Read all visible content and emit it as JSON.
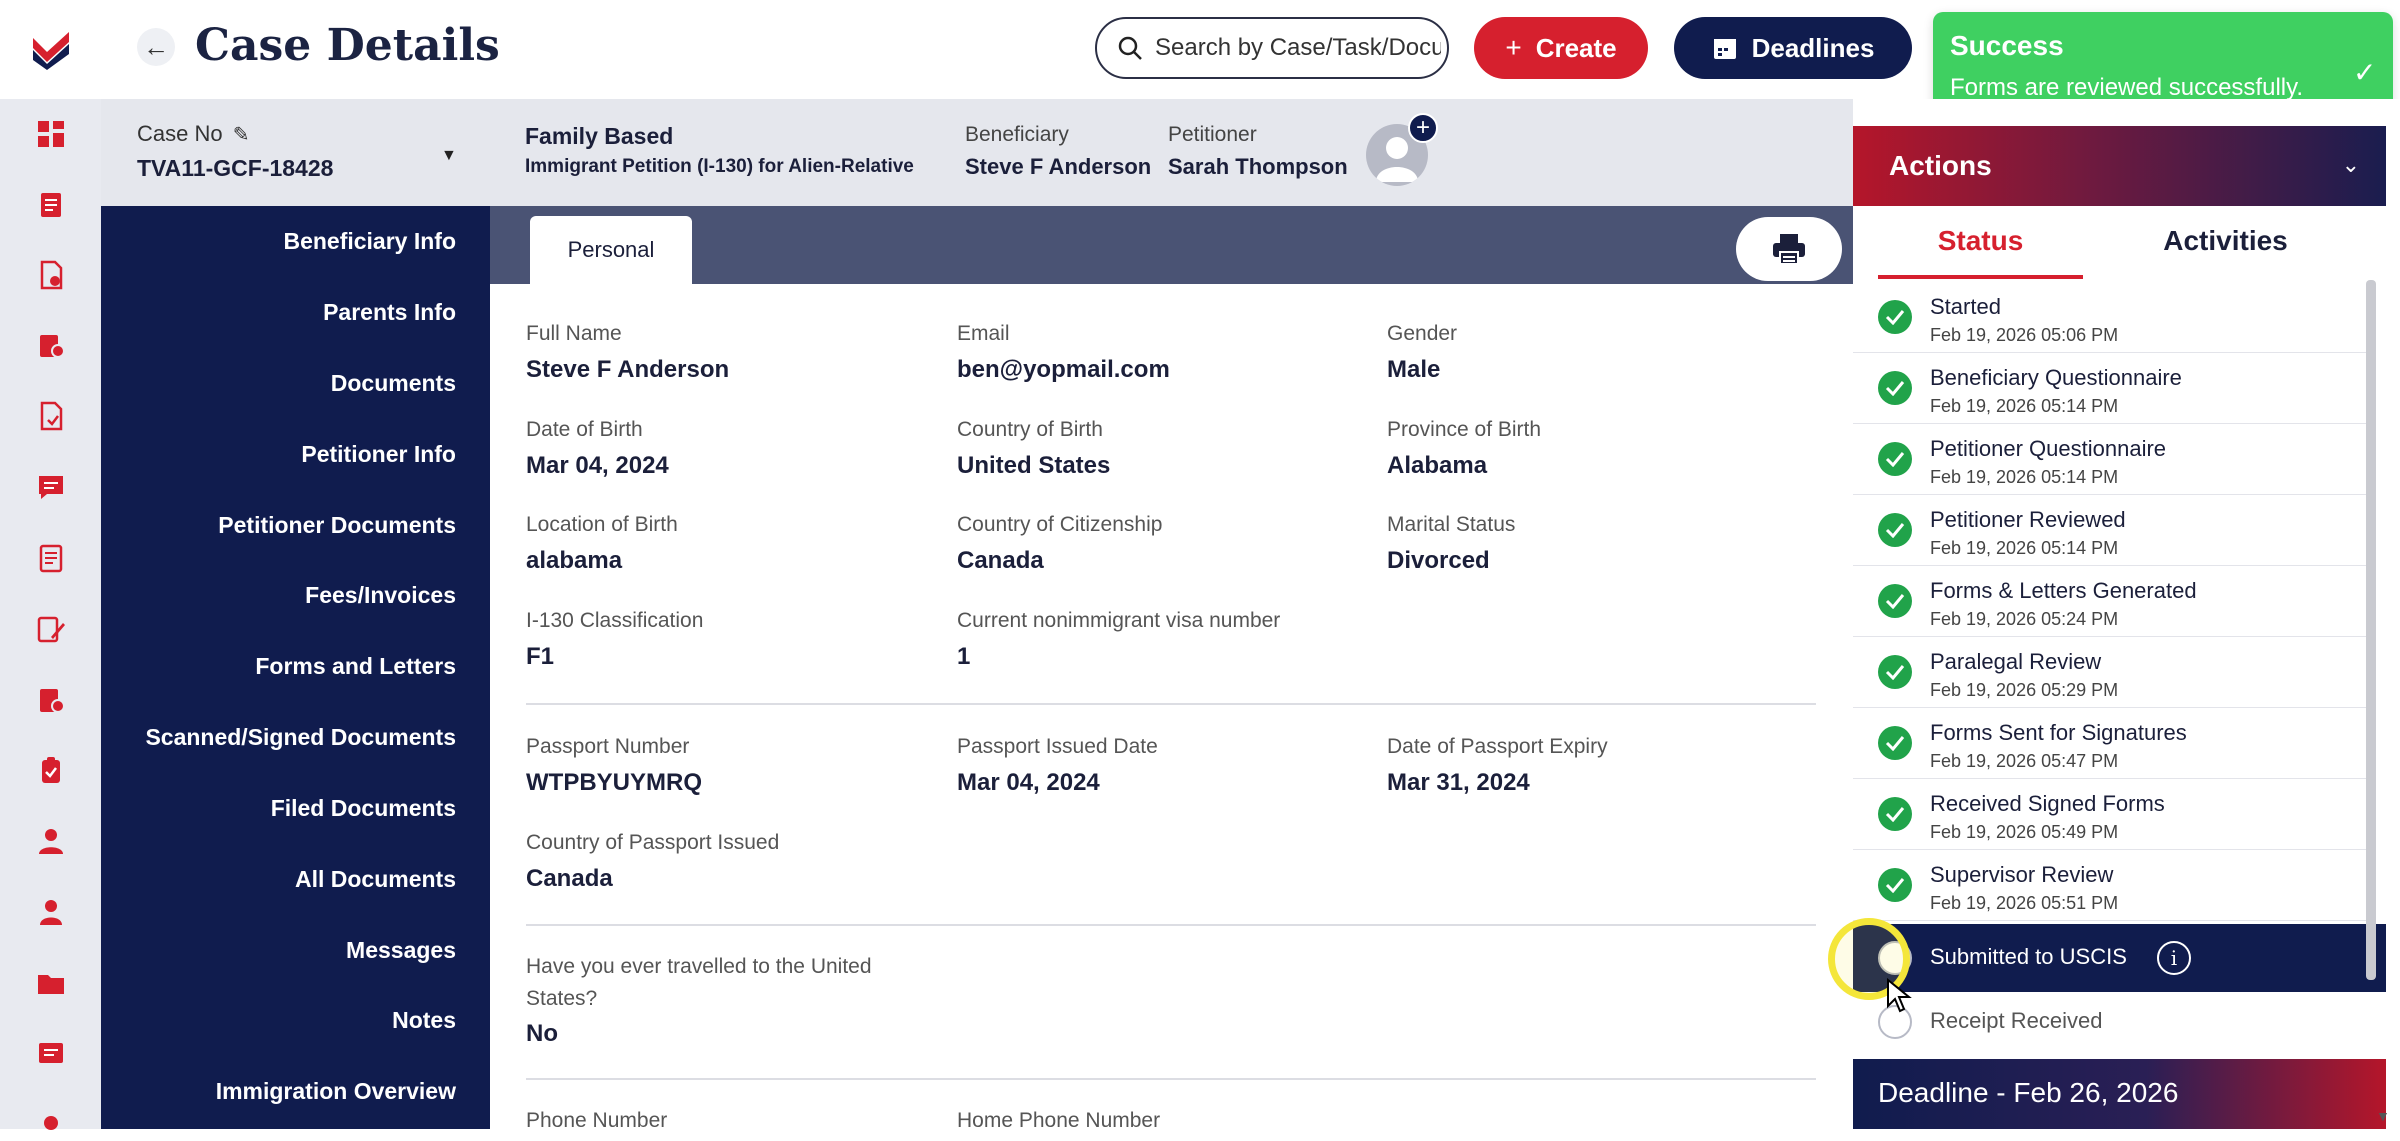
{
  "topbar": {
    "page_title": "Case Details",
    "search_placeholder": "Search by Case/Task/Docu",
    "create_label": "Create",
    "deadlines_label": "Deadlines"
  },
  "toast": {
    "title": "Success",
    "message": "Forms are reviewed successfully."
  },
  "case": {
    "case_no_label": "Case No",
    "case_no": "TVA11-GCF-18428",
    "category": "Family Based",
    "petition": "Immigrant Petition (I-130) for Alien-Relative",
    "beneficiary_label": "Beneficiary",
    "beneficiary": "Steve F Anderson",
    "petitioner_label": "Petitioner",
    "petitioner": "Sarah Thompson"
  },
  "leftnav": [
    "Beneficiary Info",
    "Parents Info",
    "Documents",
    "Petitioner Info",
    "Petitioner Documents",
    "Fees/Invoices",
    "Forms and Letters",
    "Scanned/Signed Documents",
    "Filed Documents",
    "All Documents",
    "Messages",
    "Notes",
    "Immigration Overview"
  ],
  "tabs": {
    "personal": "Personal"
  },
  "fields": {
    "full_name": {
      "label": "Full Name",
      "value": "Steve F Anderson"
    },
    "email": {
      "label": "Email",
      "value": "ben@yopmail.com"
    },
    "gender": {
      "label": "Gender",
      "value": "Male"
    },
    "dob": {
      "label": "Date of Birth",
      "value": "Mar 04, 2024"
    },
    "country_birth": {
      "label": "Country of Birth",
      "value": "United States"
    },
    "province_birth": {
      "label": "Province of Birth",
      "value": "Alabama"
    },
    "location_birth": {
      "label": "Location of Birth",
      "value": "alabama"
    },
    "citizenship": {
      "label": "Country of Citizenship",
      "value": "Canada"
    },
    "marital": {
      "label": "Marital Status",
      "value": "Divorced"
    },
    "classification": {
      "label": "I-130 Classification",
      "value": "F1"
    },
    "visa_number": {
      "label": "Current nonimmigrant visa number",
      "value": "1"
    },
    "passport_number": {
      "label": "Passport Number",
      "value": "WTPBYUYMRQ"
    },
    "passport_issued": {
      "label": "Passport Issued Date",
      "value": "Mar 04, 2024"
    },
    "passport_expiry": {
      "label": "Date of Passport Expiry",
      "value": "Mar 31, 2024"
    },
    "passport_country": {
      "label": "Country of Passport Issued",
      "value": "Canada"
    },
    "travelled_q1": "Have you ever travelled to the United",
    "travelled_q2": "States?",
    "travelled_value": "No",
    "phone": {
      "label": "Phone Number"
    },
    "home_phone": {
      "label": "Home Phone Number"
    }
  },
  "actions": {
    "title": "Actions",
    "tab_status": "Status",
    "tab_activities": "Activities",
    "steps": [
      {
        "name": "Started",
        "time": "Feb 19, 2026 05:06 PM"
      },
      {
        "name": "Beneficiary Questionnaire",
        "time": "Feb 19, 2026 05:14 PM"
      },
      {
        "name": "Petitioner Questionnaire",
        "time": "Feb 19, 2026 05:14 PM"
      },
      {
        "name": "Petitioner Reviewed",
        "time": "Feb 19, 2026 05:14 PM"
      },
      {
        "name": "Forms & Letters Generated",
        "time": "Feb 19, 2026 05:24 PM"
      },
      {
        "name": "Paralegal Review",
        "time": "Feb 19, 2026 05:29 PM"
      },
      {
        "name": "Forms Sent for Signatures",
        "time": "Feb 19, 2026 05:47 PM"
      },
      {
        "name": "Received Signed Forms",
        "time": "Feb 19, 2026 05:49 PM"
      },
      {
        "name": "Supervisor Review",
        "time": "Feb 19, 2026 05:51 PM"
      }
    ],
    "current_step": "Submitted to USCIS",
    "next_step": "Receipt Received",
    "deadline": "Deadline - Feb 26, 2026"
  },
  "colors": {
    "navy": "#101c4e",
    "red": "#d6202e",
    "success_green": "#3fd061",
    "check_green": "#21a34a"
  }
}
